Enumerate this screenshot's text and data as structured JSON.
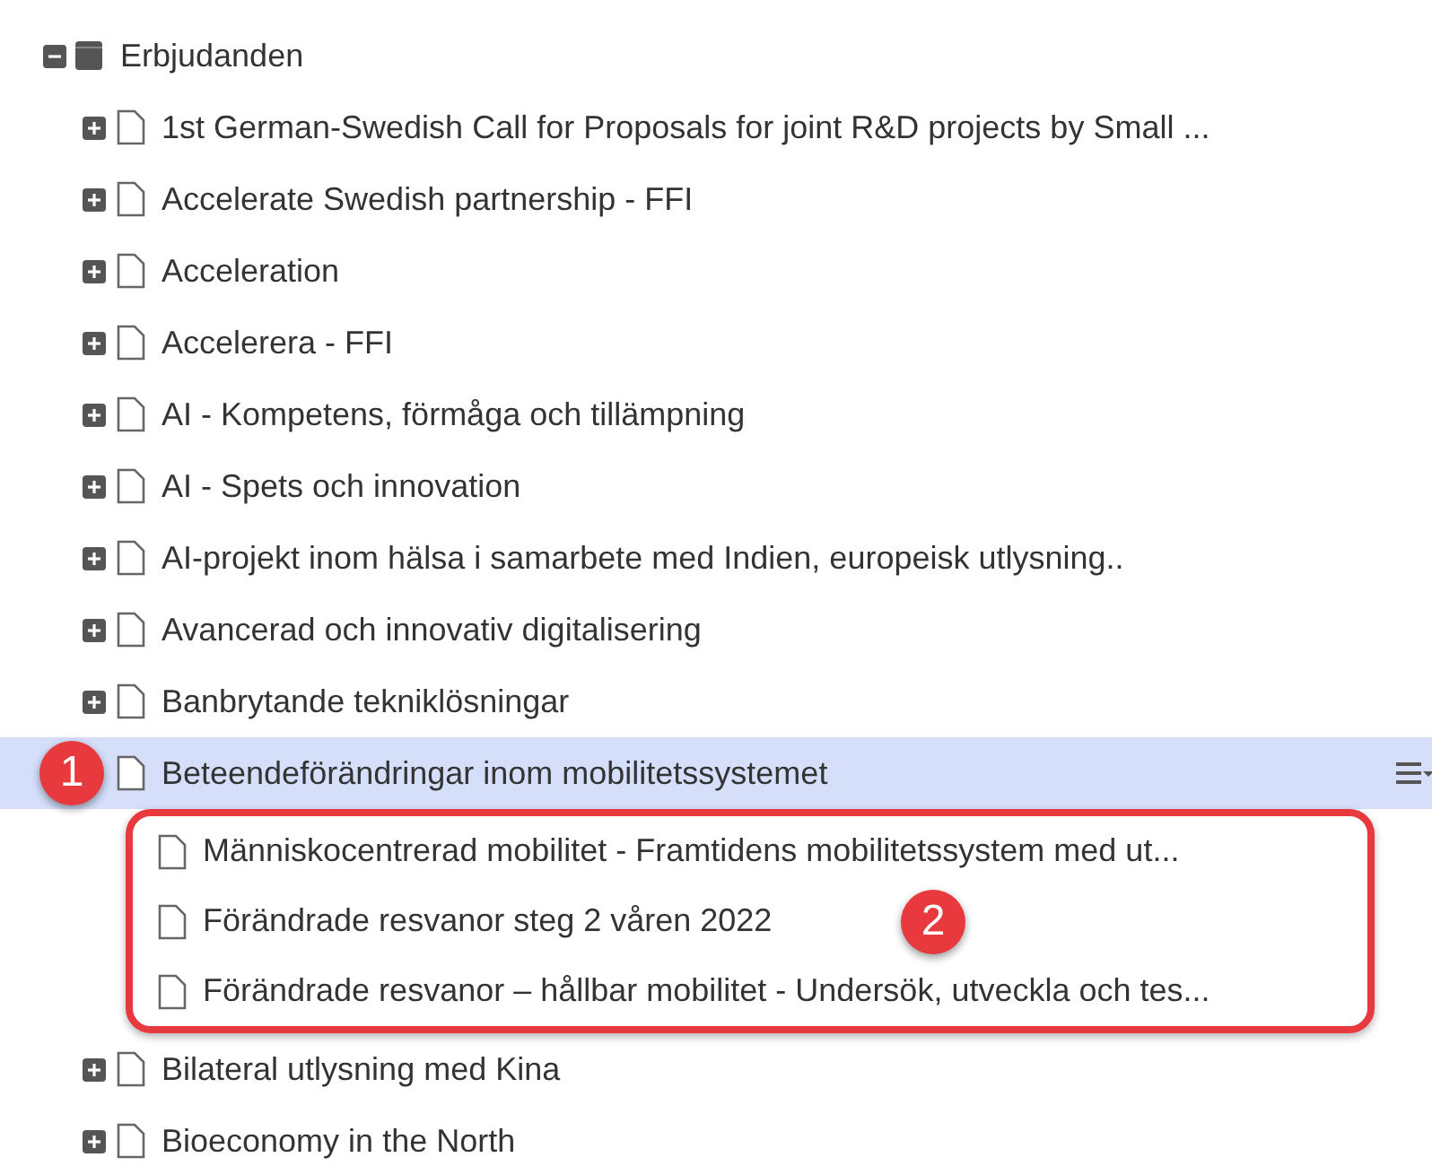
{
  "tree": {
    "label": "Erbjudanden",
    "expanded": true,
    "children": [
      {
        "label": "1st German-Swedish Call for Proposals for joint R&D projects by Small ...",
        "expanded": false,
        "selected": false
      },
      {
        "label": "Accelerate Swedish partnership - FFI",
        "expanded": false,
        "selected": false
      },
      {
        "label": "Acceleration",
        "expanded": false,
        "selected": false
      },
      {
        "label": "Accelerera - FFI",
        "expanded": false,
        "selected": false
      },
      {
        "label": "AI - Kompetens, förmåga och tillämpning",
        "expanded": false,
        "selected": false
      },
      {
        "label": "AI - Spets och innovation",
        "expanded": false,
        "selected": false
      },
      {
        "label": "AI-projekt inom hälsa i samarbete med Indien, europeisk utlysning..",
        "expanded": false,
        "selected": false
      },
      {
        "label": "Avancerad och innovativ digitalisering",
        "expanded": false,
        "selected": false
      },
      {
        "label": "Banbrytande tekniklösningar",
        "expanded": false,
        "selected": false
      },
      {
        "label": "Beteendeförändringar inom mobilitetssystemet",
        "selected": true,
        "callout": "1",
        "children_callout": "2",
        "children": [
          {
            "label": "Människocentrerad mobilitet - Framtidens mobilitetssystem med ut..."
          },
          {
            "label": "Förändrade resvanor steg 2 våren 2022"
          },
          {
            "label": "Förändrade resvanor – hållbar mobilitet - Undersök, utveckla och tes..."
          }
        ]
      },
      {
        "label": "Bilateral utlysning med Kina",
        "expanded": false,
        "selected": false
      },
      {
        "label": "Bioeconomy in the North",
        "expanded": false,
        "selected": false
      }
    ]
  }
}
